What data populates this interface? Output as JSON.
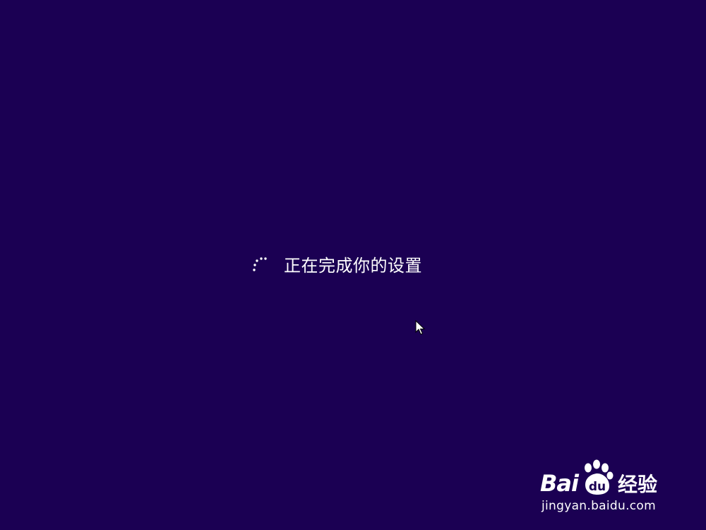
{
  "screen": {
    "background": "#1b0053",
    "status_text": "正在完成你的设置"
  },
  "spinner": {
    "icon": "loading-spinner-icon",
    "color": "#ffffff"
  },
  "cursor": {
    "icon": "mouse-pointer-icon"
  },
  "watermark": {
    "brand_left": "Bai",
    "brand_mid": "du",
    "brand_right": "经验",
    "url": "jingyan.baidu.com"
  }
}
